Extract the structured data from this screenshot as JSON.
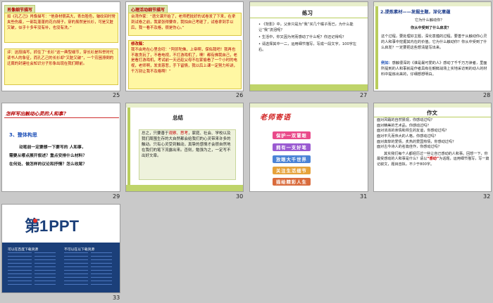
{
  "slides": {
    "s25": {
      "number": "25",
      "tag": "肖像细节描写",
      "box1": "如《孔乙己》肖像描写：“他身材很高大，青白脸色，皱纹间时常夹些伤痕，一部乱蓬蓬的花白胡子。穿的虽然是长衫，可是又脏又破，似乎十多年没有补，也没有洗。”",
      "box2": "评：这段描写，抓住了“长衫”这一典型细节，穿长衫是科举时代读书人的象征，而孔乙己的长衫却“又脏又破”，一个穷困潦倒的迂腐的封建社会知识分子形象出现在我们眼前。"
    },
    "s26": {
      "number": "26",
      "tag": "心理活动细节描写",
      "box1": "台湾作家：“语文课开始了，老师把批好的试卷发了下来，在拿到试卷之前，我紧张得要命，我怕自己考砸了，试卷拿到手以后，我一看不及格，很是伤心。”",
      "box2_title": "修改稿：",
      "box2": "我不由地在心里念叨：“阿弥陀佛，上帝啊，保佑我吧！我再也不敢贪玩了，不看电视，不打游戏机了，噢！都有佛我自己，老是看打游戏机，考试前一天还趁父母不在家偷看了一个小时的电视，老师啊，发发慈悲，手下留情，我以后上课一定努力听讲，千万别让我不及格啊！”"
    },
    "s27": {
      "number": "27",
      "title": "练习",
      "items": [
        "《背影》中，父亲只是为“我”买几个橘子而已，为什么能让“我”流泪呢？",
        "生活中，你又因为何而感动了什么呢？你还记得吗？",
        "请选择其中一二，运用细节描写，写成一段文字，100字左右。"
      ]
    },
    "s28": {
      "number": "28",
      "heading": "2.提炼素材——发掘主题，深化意蕴",
      "q1": "它为什么触动你？",
      "q2": "你从中受到了什么启发？",
      "para1": "这个过程，要处理好主题，深化意蕴的过程。要善于从触动你心灵的人和事中挖掘其内在的价值。它为什么触动你？你从中受到了什么启发？一定要把这些想清楚写出来。",
      "para2_label": "例如：",
      "para2": "感触很深的《谁是最可爱的人》感动了千千万万读者，里面所提到的人和事就是作者具有在朝鲜战场上实地采访到的动人的材料中提炼出来的，仔细想想明白。"
    },
    "s29": {
      "number": "29",
      "header": "怎样写出触动心灵的人和事？",
      "subheading": "3、整体构思",
      "lines": [
        "动笔前一定要想一下要写的 人和事，",
        "需要从哪点展开叙述？重点安排什么材料？",
        "在何处、做怎样的议论和抒情？怎么收尾？"
      ]
    },
    "s30": {
      "number": "30",
      "title": "总结",
      "text_pre": "总之，只要善于",
      "text_keyword": "观察、思考",
      "text_post": "，家庭、社会、学校以及我们周围生存的大自然都会给我们的心灵带来许多的触动。只有心灵受到触动，真挚的感情才会很自然地在我们的笔下流露出来。否则，勉强为之，一定写不出好文章。"
    },
    "s31": {
      "number": "31",
      "title": "老师寄语",
      "phrases": [
        "保护一双慧眼",
        "拥有一支好笔",
        "放眼大千世界",
        "关注生活细节",
        "描绘精彩人生"
      ]
    },
    "s32": {
      "number": "32",
      "title": "作文",
      "lines": [
        "面对风霜的自然景观，你感动过吗？",
        "面对精美的艺术品，你感动过吗？",
        "面对浓浓的亲情和师生的友谊，你感动过吗？",
        "面对平凡而伟大的人格，你感动过吗？",
        "面对真挚的爱情，炙热的爱国热情，你感动过吗？",
        "面对古今诗人的名篇佳作，你感动过吗？"
      ],
      "body_pre": "其实我们每个人都经历过一些让自己感动的人和事。回想一下，你最受感动的人和事是什么？请以",
      "body_keyword": "“感动”",
      "body_post": "为话题，运用细节描写，写一篇记叙文，题目自拟，不少于800字。"
    },
    "s33": {
      "number": "33",
      "logo_mark": "第1",
      "logo_text": "PPT",
      "link_left": "可以在百度下载资源",
      "link_right": "不可以在以下载资源"
    }
  }
}
